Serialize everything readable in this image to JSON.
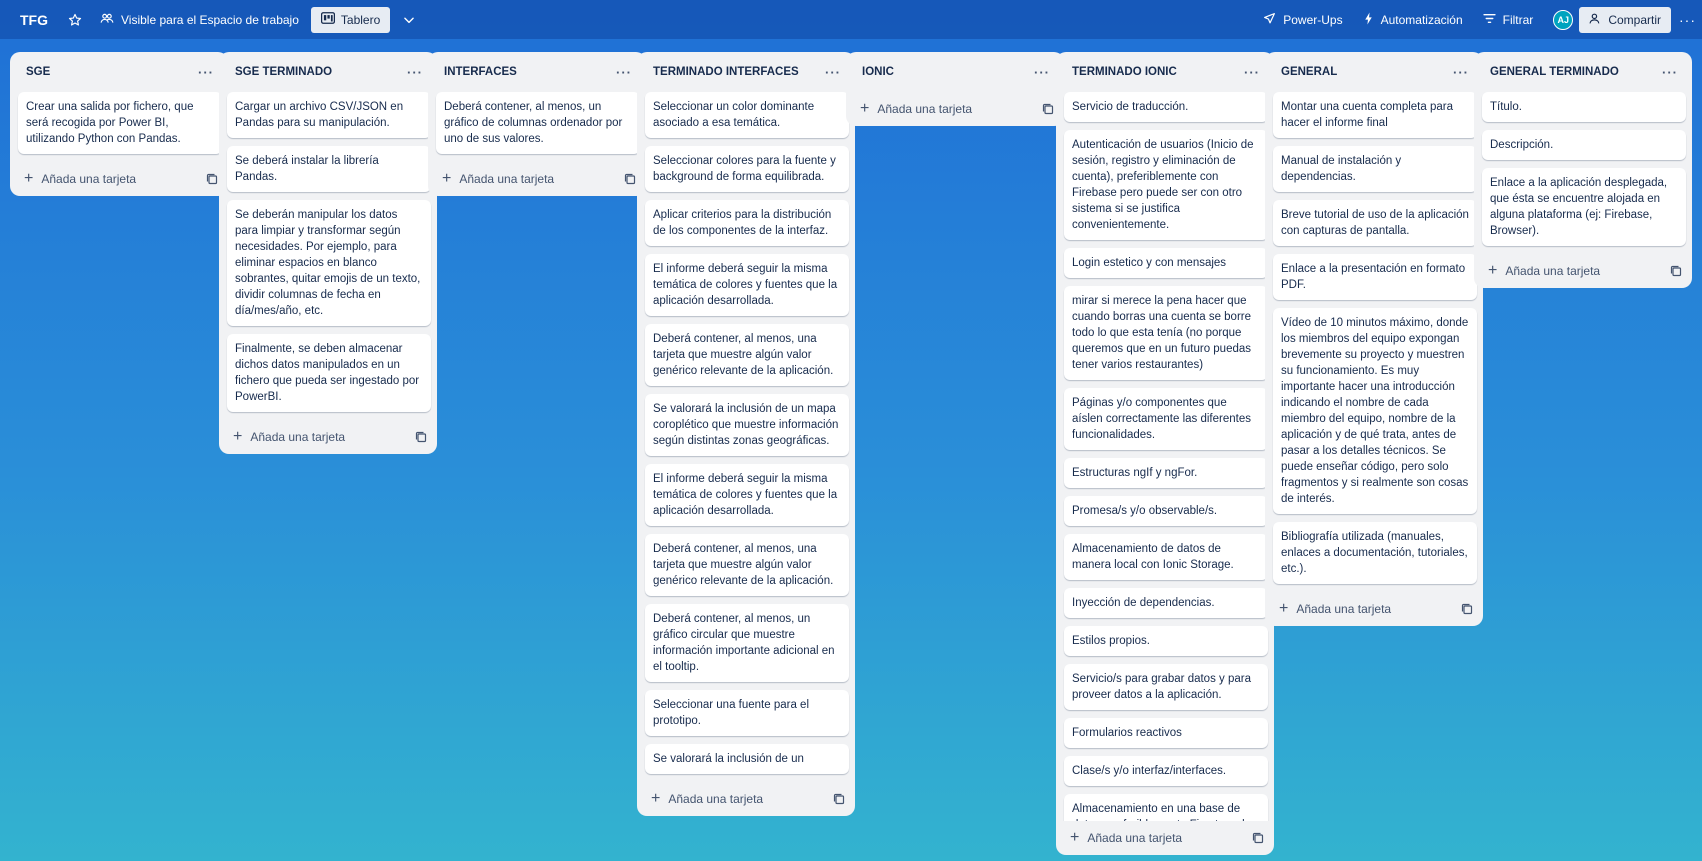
{
  "header": {
    "board_title": "TFG",
    "visibility_label": "Visible para el Espacio de trabajo",
    "view_label": "Tablero",
    "powerups_label": "Power-Ups",
    "automation_label": "Automatización",
    "filter_label": "Filtrar",
    "avatar_initials": "AJ",
    "share_label": "Compartir"
  },
  "add_card_label": "Añada una tarjeta",
  "lists": [
    {
      "title": "SGE",
      "cards": [
        "Crear una salida por fichero, que será recogida por Power BI, utilizando Python con Pandas."
      ]
    },
    {
      "title": "SGE TERMINADO",
      "cards": [
        "Cargar un archivo CSV/JSON en Pandas para su manipulación.",
        "Se deberá instalar la librería Pandas.",
        "Se deberán manipular los datos para limpiar y transformar según necesidades. Por ejemplo, para eliminar espacios en blanco sobrantes, quitar emojis de un texto, dividir columnas de fecha en día/mes/año, etc.",
        "Finalmente, se deben almacenar dichos datos manipulados en un fichero que pueda ser ingestado por PowerBI."
      ]
    },
    {
      "title": "INTERFACES",
      "cards": [
        "Deberá contener, al menos, un gráfico de columnas ordenador por uno de sus valores."
      ]
    },
    {
      "title": "TERMINADO INTERFACES",
      "cards": [
        "Seleccionar un color dominante asociado a esa temática.",
        "Seleccionar colores para la fuente y background de forma equilibrada.",
        "Aplicar criterios para la distribución de los componentes de la interfaz.",
        "El informe deberá seguir la misma temática de colores y fuentes que la aplicación desarrollada.",
        "Deberá contener, al menos, una tarjeta que muestre algún valor genérico relevante de la aplicación.",
        "Se valorará la inclusión de un mapa coroplético que muestre información según distintas zonas geográficas.",
        "El informe deberá seguir la misma temática de colores y fuentes que la aplicación desarrollada.",
        "Deberá contener, al menos, una tarjeta que muestre algún valor genérico relevante de la aplicación.",
        "Deberá contener, al menos, un gráfico circular que muestre información importante adicional en el tooltip.",
        "Seleccionar una fuente para el prototipo.",
        "Se valorará la inclusión de un"
      ]
    },
    {
      "title": "IONIC",
      "cards": []
    },
    {
      "title": "TERMINADO IONIC",
      "cards": [
        "Servicio de traducción.",
        "Autenticación de usuarios (Inicio de sesión, registro y eliminación de cuenta), preferiblemente con Firebase pero puede ser con otro sistema si se justifica convenientemente.",
        "Login estetico y con mensajes",
        "mirar si merece la pena hacer que cuando borras una cuenta se borre todo lo que esta tenía (no porque queremos que en un futuro puedas tener varios restaurantes)",
        "Páginas y/o componentes que aíslen correctamente las diferentes funcionalidades.",
        "Estructuras ngIf y ngFor.",
        "Promesa/s y/o observable/s.",
        "Almacenamiento de datos de manera local con Ionic Storage.",
        "Inyección de dependencias.",
        "Estilos propios.",
        "Servicio/s para grabar datos y para proveer datos a la aplicación.",
        "Formularios reactivos",
        "Clase/s y/o interfaz/interfaces.",
        "Almacenamiento en una base de datos, preferiblemente Firestore de Firebase aunque puede ser otra"
      ]
    },
    {
      "title": "GENERAL",
      "cards": [
        "Montar una cuenta completa para hacer el informe final",
        "Manual de instalación y dependencias.",
        "Breve tutorial de uso de la aplicación con capturas de pantalla.",
        "Enlace a la presentación en formato PDF.",
        "Vídeo de 10 minutos máximo, donde los miembros del equipo expongan brevemente su proyecto y muestren su funcionamiento. Es muy importante hacer una introducción indicando el nombre de cada miembro del equipo, nombre de la aplicación y de qué trata, antes de pasar a los detalles técnicos. Se puede enseñar código, pero solo fragmentos y si realmente son cosas de interés.",
        "Bibliografía utilizada (manuales, enlaces a documentación, tutoriales, etc.)."
      ]
    },
    {
      "title": "GENERAL TERMINADO",
      "cards": [
        "Título.",
        "Descripción.",
        "Enlace a la aplicación desplegada, que ésta se encuentre alojada en alguna plataforma (ej: Firebase, Browser)."
      ]
    }
  ]
}
